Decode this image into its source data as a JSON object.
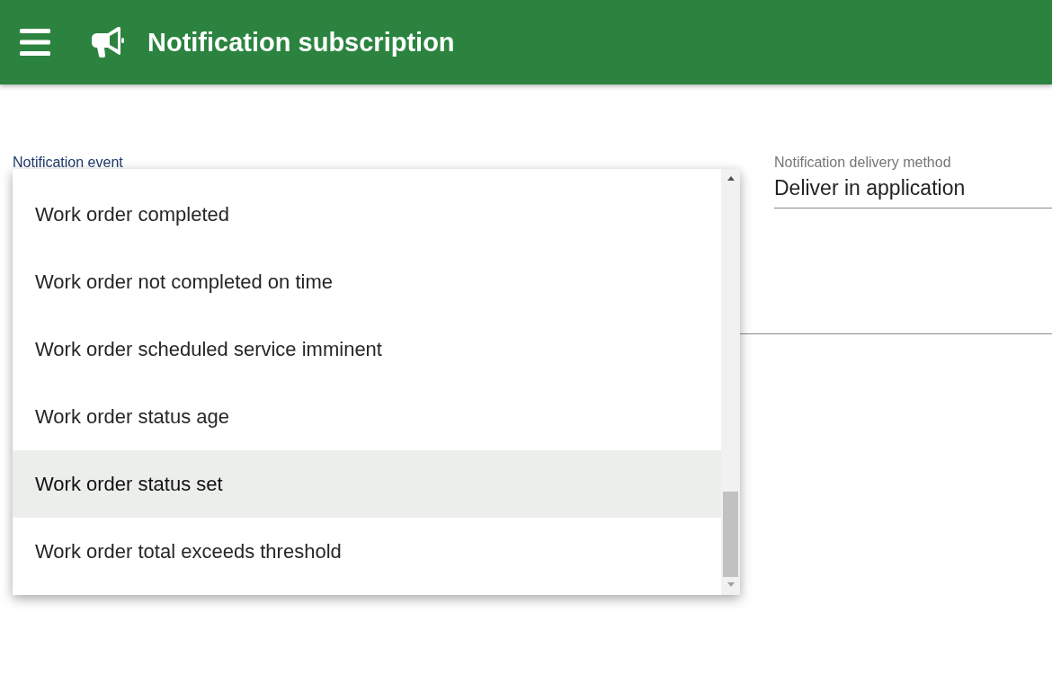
{
  "app_bar": {
    "title": "Notification subscription"
  },
  "event_field": {
    "label": "Notification event",
    "options": [
      {
        "label": "Work order completed",
        "selected": false
      },
      {
        "label": "Work order not completed on time",
        "selected": false
      },
      {
        "label": "Work order scheduled service imminent",
        "selected": false
      },
      {
        "label": "Work order status age",
        "selected": false
      },
      {
        "label": "Work order status set",
        "selected": true
      },
      {
        "label": "Work order total exceeds threshold",
        "selected": false
      }
    ]
  },
  "delivery_field": {
    "label": "Notification delivery method",
    "value": "Deliver in application"
  }
}
